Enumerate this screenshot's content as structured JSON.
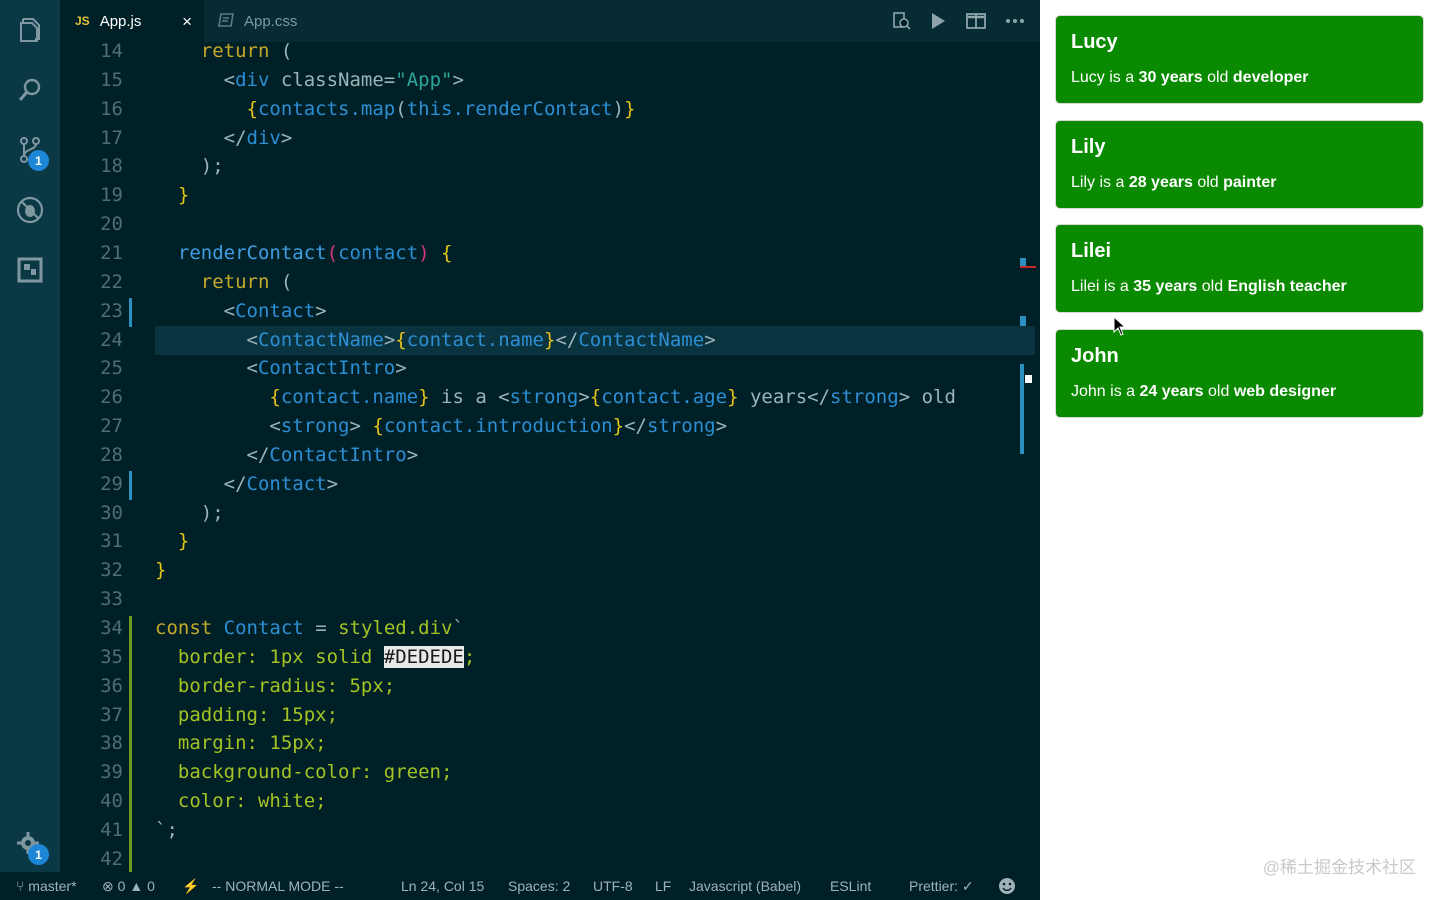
{
  "editor": {
    "tabs": [
      {
        "icon": "JS",
        "label": "App.js",
        "active": true
      },
      {
        "icon": "css-file-icon",
        "label": "App.css",
        "active": false
      }
    ],
    "close_glyph": "×",
    "activity_badges": {
      "source_control": "1",
      "settings": "1"
    },
    "toolbar_icons": [
      "open-changes-icon",
      "run-icon",
      "split-editor-icon",
      "more-icon"
    ],
    "current_line": 24,
    "code_lines": [
      {
        "n": "14",
        "text": "    return ("
      },
      {
        "n": "15",
        "text": "      <div className=\"App\">"
      },
      {
        "n": "16",
        "text": "        {contacts.map(this.renderContact)}"
      },
      {
        "n": "17",
        "text": "      </div>"
      },
      {
        "n": "18",
        "text": "    );"
      },
      {
        "n": "19",
        "text": "  }"
      },
      {
        "n": "20",
        "text": ""
      },
      {
        "n": "21",
        "text": "  renderContact(contact) {"
      },
      {
        "n": "22",
        "text": "    return ("
      },
      {
        "n": "23",
        "text": "      <Contact>"
      },
      {
        "n": "24",
        "text": "        <ContactName>{contact.name}</ContactName>"
      },
      {
        "n": "25",
        "text": "        <ContactIntro>"
      },
      {
        "n": "26",
        "text": "          {contact.name} is a <strong>{contact.age} years</strong> old"
      },
      {
        "n": "27",
        "text": "          <strong> {contact.introduction}</strong>"
      },
      {
        "n": "28",
        "text": "        </ContactIntro>"
      },
      {
        "n": "29",
        "text": "      </Contact>"
      },
      {
        "n": "30",
        "text": "    );"
      },
      {
        "n": "31",
        "text": "  }"
      },
      {
        "n": "32",
        "text": "}"
      },
      {
        "n": "33",
        "text": ""
      },
      {
        "n": "34",
        "text": "const Contact = styled.div`"
      },
      {
        "n": "35",
        "text": "  border: 1px solid #DEDEDE;"
      },
      {
        "n": "36",
        "text": "  border-radius: 5px;"
      },
      {
        "n": "37",
        "text": "  padding: 15px;"
      },
      {
        "n": "38",
        "text": "  margin: 15px;"
      },
      {
        "n": "39",
        "text": "  background-color: green;"
      },
      {
        "n": "40",
        "text": "  color: white;"
      },
      {
        "n": "41",
        "text": "`;"
      },
      {
        "n": "42",
        "text": ""
      }
    ]
  },
  "status": {
    "branch": "master*",
    "errors": "0",
    "warnings": "0",
    "mode": "-- NORMAL MODE --",
    "position": "Ln 24, Col 15",
    "spaces": "Spaces: 2",
    "encoding": "UTF-8",
    "eol": "LF",
    "language": "Javascript (Babel)",
    "linter": "ESLint",
    "prettier": "Prettier: ✓"
  },
  "preview": {
    "contacts": [
      {
        "name": "Lucy",
        "intro_name": "Lucy",
        "is_a": " is a ",
        "age": "30 years",
        "old": " old ",
        "role": "developer"
      },
      {
        "name": "Lily",
        "intro_name": "Lily",
        "is_a": " is a ",
        "age": "28 years",
        "old": " old ",
        "role": "painter"
      },
      {
        "name": "Lilei",
        "intro_name": "Lilei",
        "is_a": " is a ",
        "age": "35 years",
        "old": " old ",
        "role": "English teacher"
      },
      {
        "name": "John",
        "intro_name": "John",
        "is_a": " is a ",
        "age": "24 years",
        "old": " old ",
        "role": "web designer"
      }
    ],
    "watermark": "@稀土掘金技术社区"
  },
  "colors": {
    "editor_bg": "#002028",
    "activity_bg": "#0b3845",
    "card_bg": "#0a8a00",
    "badge": "#1e86d6"
  }
}
